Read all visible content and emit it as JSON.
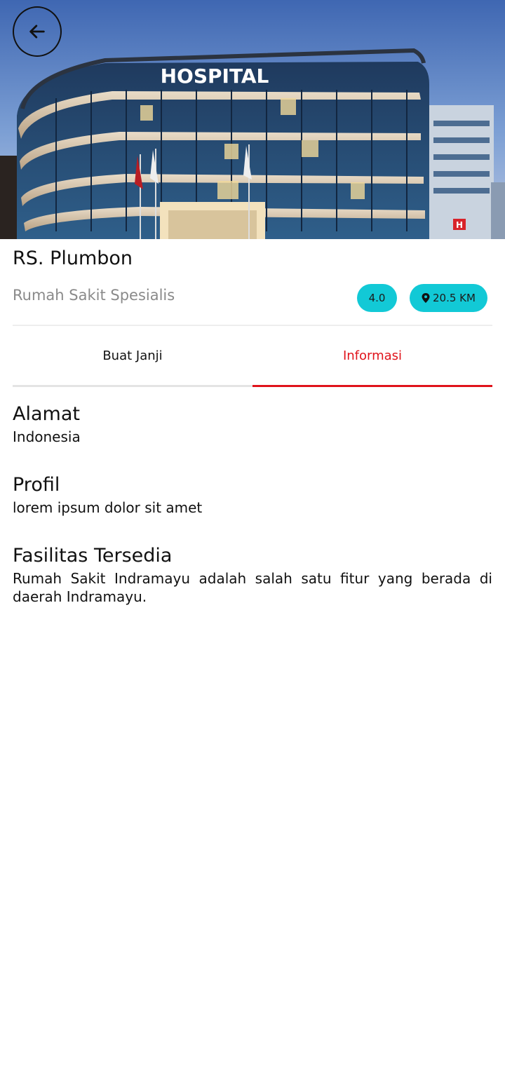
{
  "hero": {
    "sign_text": "HOSPITAL"
  },
  "hospital": {
    "name": "RS. Plumbon",
    "type": "Rumah Sakit Spesialis",
    "rating": "4.0",
    "distance": "20.5 KM"
  },
  "tabs": [
    {
      "label": "Buat Janji",
      "active": false
    },
    {
      "label": "Informasi",
      "active": true
    }
  ],
  "sections": {
    "address": {
      "title": "Alamat",
      "body": "Indonesia"
    },
    "profile": {
      "title": "Profil",
      "body": "lorem ipsum dolor sit amet"
    },
    "facilities": {
      "title": "Fasilitas Tersedia",
      "body": "Rumah Sakit Indramayu adalah salah satu fitur yang berada di daerah Indramayu."
    }
  },
  "icons": {
    "back": "arrow-left-icon",
    "location": "map-pin-icon"
  },
  "colors": {
    "accent_red": "#e0131b",
    "badge_cyan": "#12c9d6",
    "muted_text": "#8a8a8a"
  }
}
